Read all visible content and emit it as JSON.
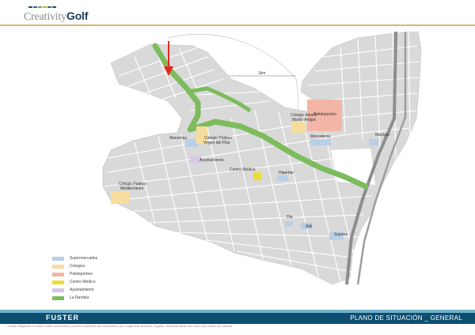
{
  "header": {
    "logo_prefix": "Creativity",
    "logo_suffix": "Golf",
    "logo_bar_colors": [
      "#1e4f72",
      "#2b6b8f",
      "#7aa23f",
      "#c9a64b",
      "#2b6b8f",
      "#1e4f72"
    ],
    "accent_line_color": "#d7b56d"
  },
  "map": {
    "scale_label": "1km",
    "labels": {
      "polideportivo": "Polideportivo",
      "colegio_martin_line1": "Colegio Infantil",
      "colegio_martin_line2": "Martín Artigot",
      "mercadona": "Mercadona",
      "mamper": "Mamper",
      "maruimas": "Maruimas",
      "colegio_pilar_line1": "Colegio Público",
      "colegio_pilar_line2": "Virgen del Pilar",
      "ayuntamiento": "Ayuntamiento",
      "centro_medico": "Centro Médico",
      "hiperber": "Hiperber",
      "colegio_med_line1": "Colegio Público",
      "colegio_med_line2": "Mediterráneo",
      "dia": "Dia",
      "aldi": "Aldi",
      "supeco": "Supeco"
    },
    "colors": {
      "background": "#ffffff",
      "block": "#d9d9d9",
      "street": "#ffffff",
      "rambla": "#7dbb5c",
      "supermercados": "#b9cfe6",
      "colegios": "#f6dd9e",
      "polideportivo": "#f3b6a6",
      "centro_medico": "#e9dc3a",
      "ayuntamiento": "#d9c7e6",
      "marker": "#e22a1c"
    }
  },
  "legend": {
    "items": [
      {
        "label": "Supermercados",
        "color": "#b9cfe6"
      },
      {
        "label": "Colegios",
        "color": "#f6dd9e"
      },
      {
        "label": "Polideportivo",
        "color": "#f3b6a6"
      },
      {
        "label": "Centro Médico",
        "color": "#e9dc3a"
      },
      {
        "label": "Ayuntamiento",
        "color": "#d9c7e6"
      },
      {
        "label": "La Rambla",
        "color": "#7dbb5c"
      }
    ]
  },
  "footer": {
    "brand": "FUSTER",
    "plan_title": "PLANO DE SITUACIÓN _ GENERAL",
    "disclaimer": "* Estas imágenes no tienen valor contractual y podrán experimentar variaciones por exigencias técnicas, legales, administrativas así como por criterio de calidad.",
    "bar_color": "#0e4e70",
    "accent_color": "#6fb0c9"
  }
}
